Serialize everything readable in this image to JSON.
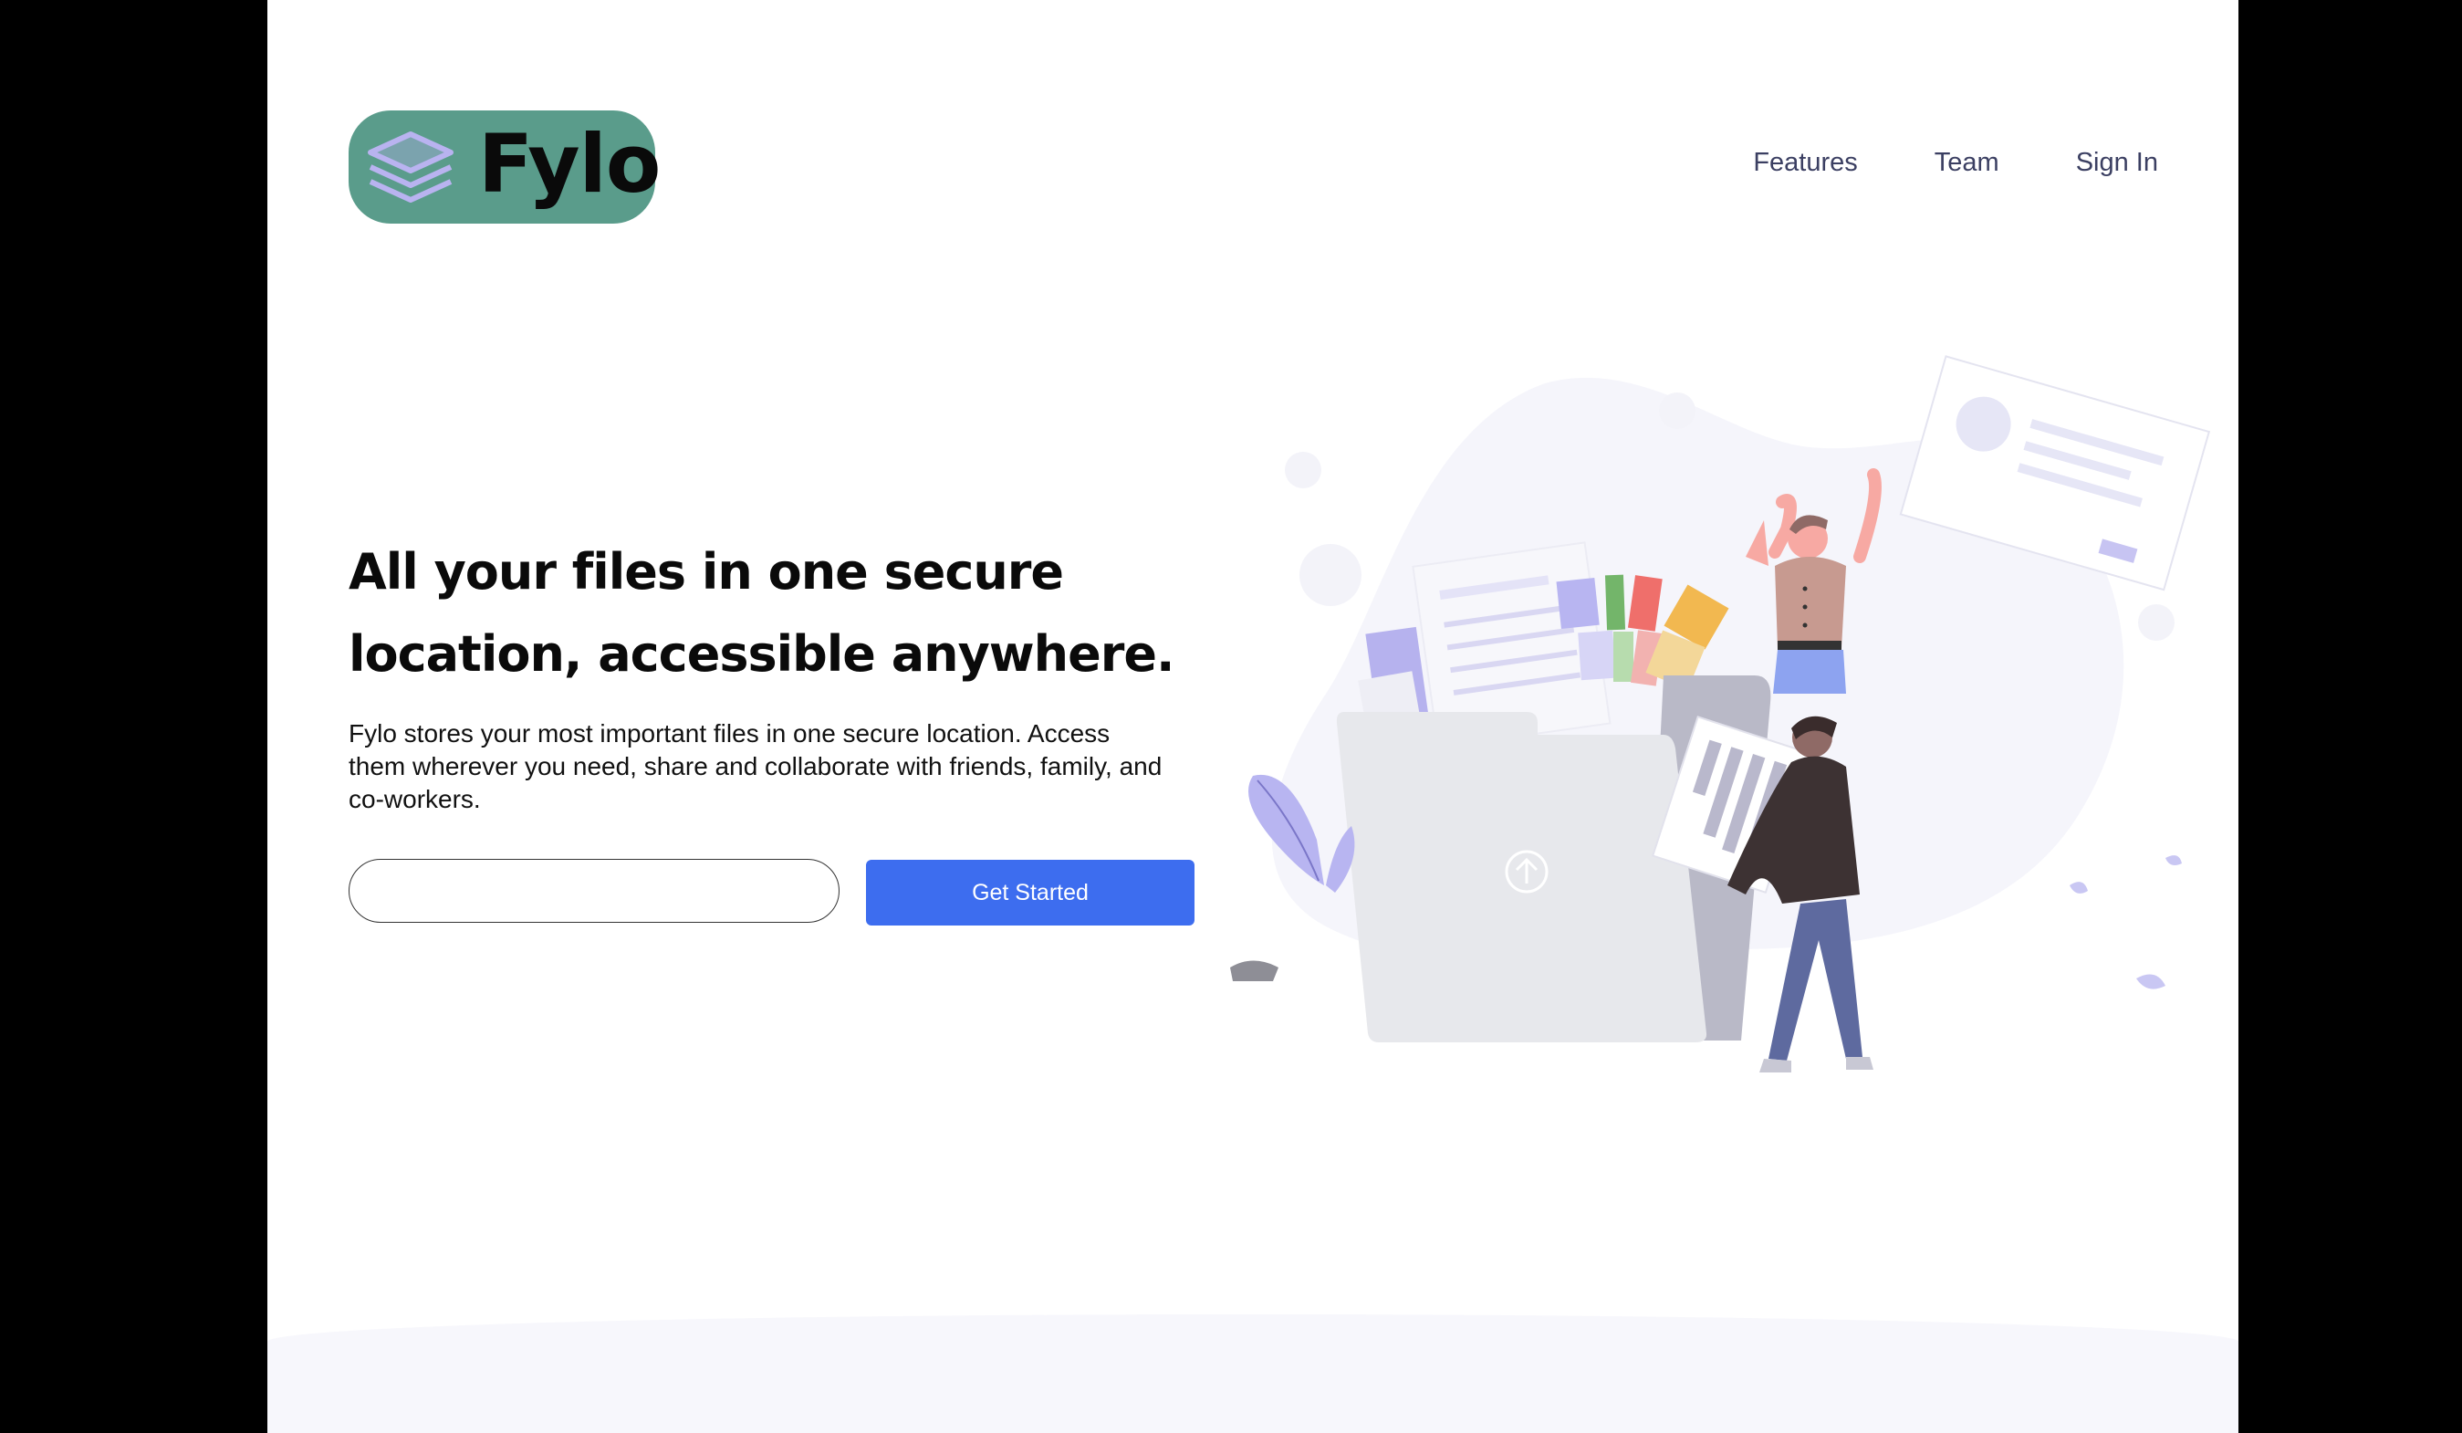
{
  "brand": {
    "name": "Fylo",
    "logo_bg": "#5a9c8b",
    "logo_icon": "stacked-layers-icon"
  },
  "nav": {
    "items": [
      {
        "label": "Features"
      },
      {
        "label": "Team"
      },
      {
        "label": "Sign In"
      }
    ]
  },
  "hero": {
    "title": "All your files in one secure location, accessible anywhere.",
    "description": "Fylo stores your most important files in one secure location. Access them wherever you need, share and collaborate with friends, family, and co-workers.",
    "email_value": "",
    "email_placeholder": "",
    "cta_label": "Get Started",
    "cta_color": "#3d6def",
    "illustration": "intro-illustration"
  },
  "colors": {
    "text": "#0a0a0a",
    "nav": "#3b3f62",
    "bottom_band": "#f7f7fc"
  }
}
